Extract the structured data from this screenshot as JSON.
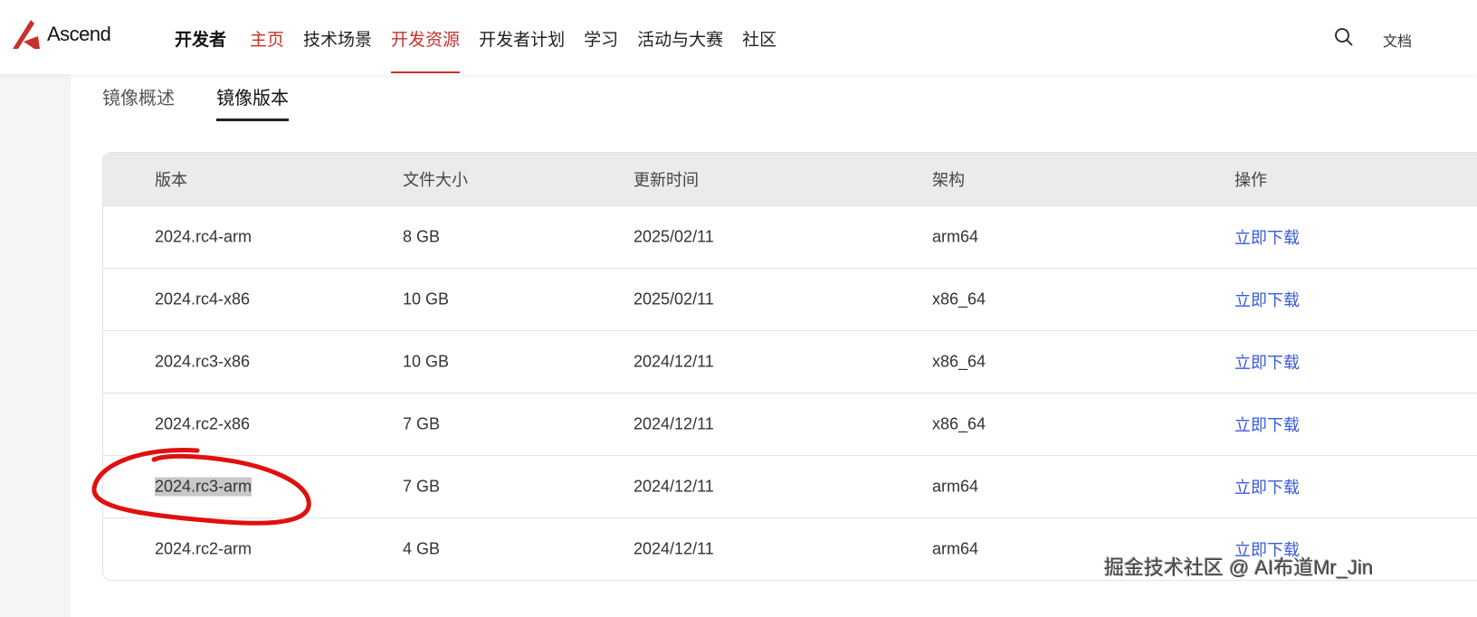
{
  "header": {
    "logo": "Ascend",
    "brand": "开发者",
    "nav": [
      "主页",
      "技术场景",
      "开发资源",
      "开发者计划",
      "学习",
      "活动与大赛",
      "社区"
    ],
    "docs": "文档"
  },
  "tabs": [
    "镜像概述",
    "镜像版本"
  ],
  "table": {
    "columns": [
      "版本",
      "文件大小",
      "更新时间",
      "架构",
      "操作"
    ],
    "rows": [
      [
        "2024.rc4-arm",
        "8 GB",
        "2025/02/11",
        "arm64",
        "立即下载"
      ],
      [
        "2024.rc4-x86",
        "10 GB",
        "2025/02/11",
        "x86_64",
        "立即下载"
      ],
      [
        "2024.rc3-x86",
        "10 GB",
        "2024/12/11",
        "x86_64",
        "立即下载"
      ],
      [
        "2024.rc2-x86",
        "7 GB",
        "2024/12/11",
        "x86_64",
        "立即下载"
      ],
      [
        "2024.rc3-arm",
        "7 GB",
        "2024/12/11",
        "arm64",
        "立即下载"
      ],
      [
        "2024.rc2-arm",
        "4 GB",
        "2024/12/11",
        "arm64",
        "立即下载"
      ]
    ]
  },
  "watermark": "掘金技术社区 @ AI布道Mr_Jin",
  "colors": {
    "accent": "#c7322c",
    "link": "#3b5bdb"
  }
}
